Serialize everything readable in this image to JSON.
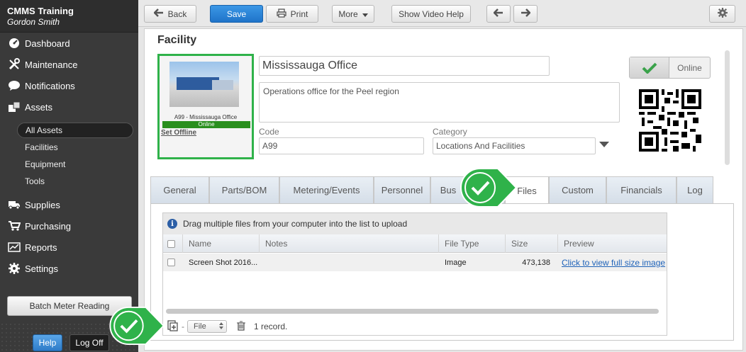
{
  "sidebar": {
    "app_name": "CMMS Training",
    "user_name": "Gordon Smith",
    "nav": [
      {
        "label": "Dashboard",
        "icon": "dashboard-icon"
      },
      {
        "label": "Maintenance",
        "icon": "tools-icon"
      },
      {
        "label": "Notifications",
        "icon": "chat-bubble-icon"
      },
      {
        "label": "Assets",
        "icon": "boxes-icon"
      }
    ],
    "asset_sub": [
      "All Assets",
      "Facilities",
      "Equipment",
      "Tools"
    ],
    "nav2": [
      {
        "label": "Supplies",
        "icon": "truck-icon"
      },
      {
        "label": "Purchasing",
        "icon": "cart-icon"
      },
      {
        "label": "Reports",
        "icon": "chart-icon"
      },
      {
        "label": "Settings",
        "icon": "gear-icon"
      }
    ],
    "batch_meter_reading": "Batch Meter Reading",
    "help": "Help",
    "log_off": "Log Off"
  },
  "toolbar": {
    "back": "Back",
    "save": "Save",
    "print": "Print",
    "more": "More",
    "show_video_help": "Show Video Help"
  },
  "facility": {
    "heading": "Facility",
    "photo_caption": "A99 - Mississauga Office",
    "photo_status": "Online",
    "set_offline": "Set Offline",
    "name": "Mississauga Office",
    "description": "Operations office for the Peel region",
    "code_label": "Code",
    "code": "A99",
    "category_label": "Category",
    "category": "Locations And Facilities",
    "online_label": "Online"
  },
  "tabs": [
    "General",
    "Parts/BOM",
    "Metering/Events",
    "Personnel",
    "Bus",
    "Files",
    "Custom",
    "Financials",
    "Log"
  ],
  "files": {
    "info": "Drag multiple files from your computer into the list to upload",
    "columns": [
      "Name",
      "Notes",
      "File Type",
      "Size",
      "Preview"
    ],
    "rows": [
      {
        "name": "Screen Shot 2016...",
        "notes": "",
        "file_type": "Image",
        "size": "473,138",
        "preview": "Click to view full size image"
      }
    ],
    "file_select": "File",
    "record_count": "1 record."
  },
  "colors": {
    "accent_green": "#2fb24a",
    "primary_blue": "#1f74c9",
    "sidebar_bg": "#3a3a3a"
  }
}
